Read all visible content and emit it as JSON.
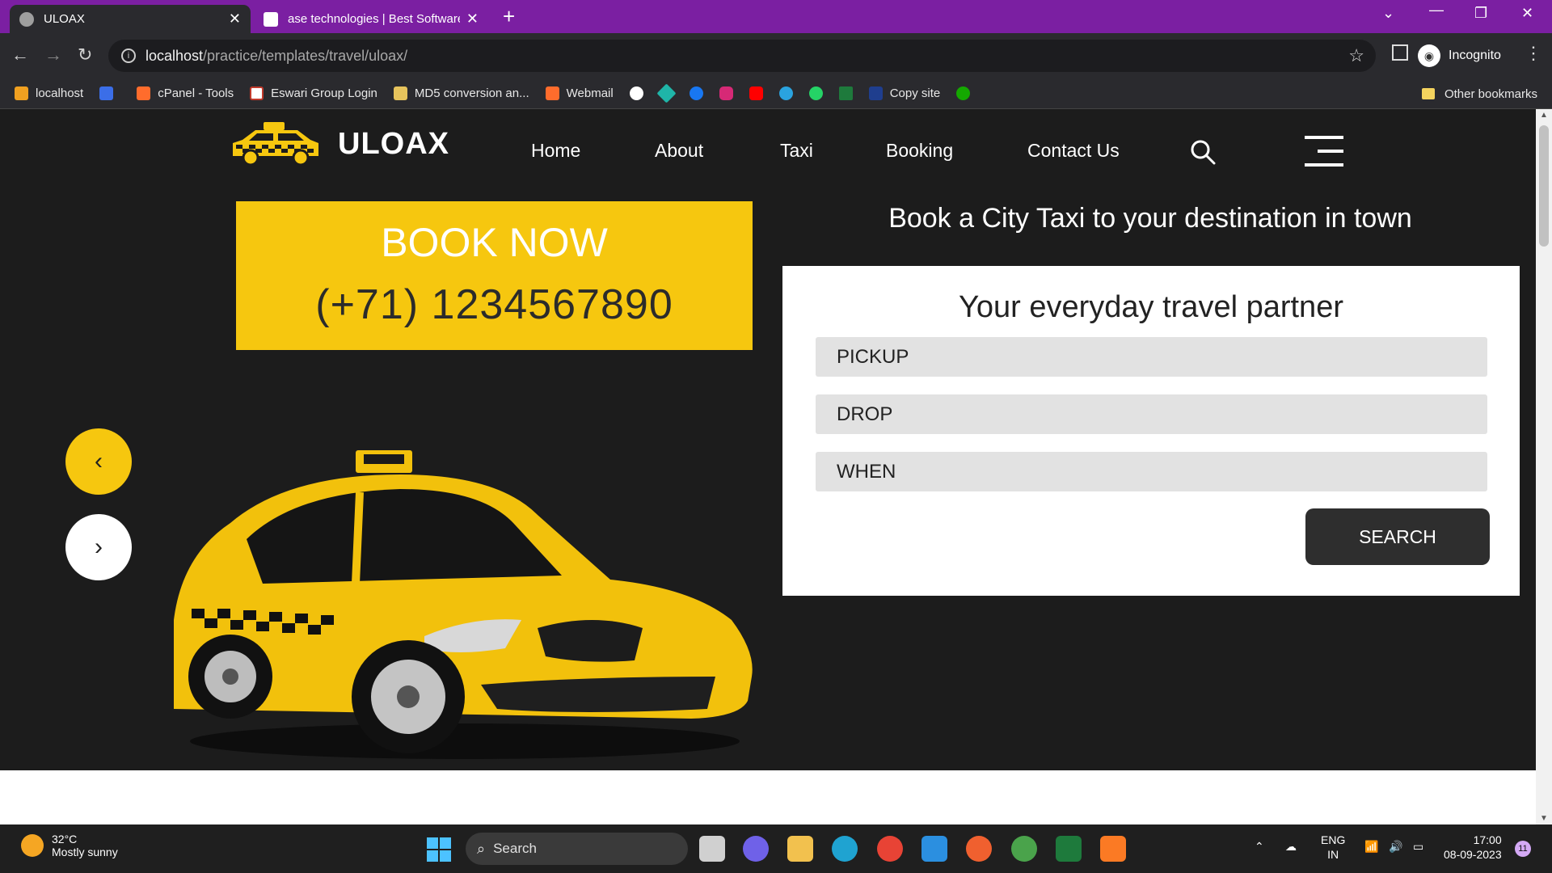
{
  "browser": {
    "tabs": [
      {
        "title": "ULOAX",
        "favicon_color": "#9e9e9e"
      },
      {
        "title": "ase technologies | Best Software",
        "favicon_color": "#ffffff"
      }
    ],
    "url_host": "localhost",
    "url_path": "/practice/templates/travel/uloax/",
    "profile_label": "Incognito",
    "bookmarks": [
      {
        "label": "localhost",
        "icon_color": "#f0a020"
      },
      {
        "label": "",
        "icon_color": "#3b6ee8"
      },
      {
        "label": "cPanel - Tools",
        "icon_color": "#ff6c2c"
      },
      {
        "label": "Eswari Group Login",
        "icon_color": "#ffffff"
      },
      {
        "label": "MD5 conversion an...",
        "icon_color": "#e6c35c"
      },
      {
        "label": "Webmail",
        "icon_color": "#ff6c2c"
      }
    ],
    "bookmark_icons": [
      {
        "name": "github-icon",
        "color": "#ffffff"
      },
      {
        "name": "diamond-icon",
        "color": "#1fb5a8"
      },
      {
        "name": "facebook-icon",
        "color": "#1877f2"
      },
      {
        "name": "instagram-icon",
        "color": "#d62976"
      },
      {
        "name": "youtube-icon",
        "color": "#ff0000"
      },
      {
        "name": "telegram-icon",
        "color": "#2aa3df"
      },
      {
        "name": "whatsapp-icon",
        "color": "#25d366"
      },
      {
        "name": "sheet-icon",
        "color": "#1e7a3c"
      }
    ],
    "bookmark_copysite": {
      "label": "Copy site",
      "icon_color": "#1f3e8e"
    },
    "bookmark_upwork_color": "#14a800",
    "other_bookmarks": "Other bookmarks"
  },
  "site": {
    "brand": "ULOAX",
    "nav": [
      "Home",
      "About",
      "Taxi",
      "Booking",
      "Contact Us"
    ],
    "book_now_title": "BOOK NOW",
    "book_now_phone": "(+71) 1234567890",
    "headline": "Book a City Taxi to your destination in town",
    "form": {
      "title": "Your everyday travel partner",
      "fields": [
        "PICKUP",
        "DROP",
        "WHEN"
      ],
      "search_label": "SEARCH"
    },
    "colors": {
      "accent": "#f6c70f",
      "hero_bg": "#1c1c1c"
    }
  },
  "taskbar": {
    "weather_temp": "32°C",
    "weather_desc": "Mostly sunny",
    "search_placeholder": "Search",
    "lang_top": "ENG",
    "lang_bottom": "IN",
    "time": "17:00",
    "date": "08-09-2023",
    "notif_count": "11"
  }
}
